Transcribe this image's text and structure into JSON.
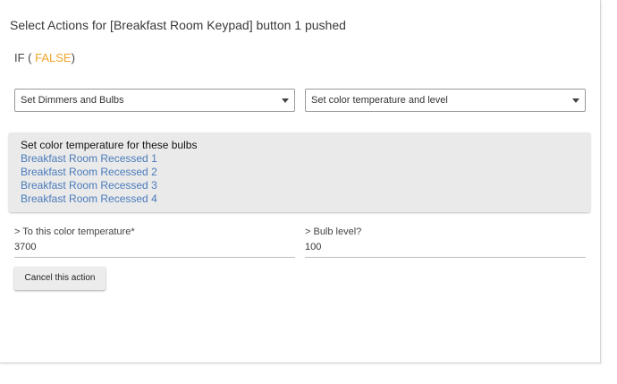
{
  "heading": "Select Actions for [Breakfast Room Keypad] button 1 pushed",
  "condition": {
    "prefix": "IF ( ",
    "value": "FALSE",
    "suffix": ")"
  },
  "colors": {
    "false_text": "#f0a52c",
    "link_text": "#4a7bbb"
  },
  "action_category_select": {
    "value": "Set Dimmers and Bulbs",
    "icon": "chevron-down-icon"
  },
  "action_type_select": {
    "value": "Set color temperature and level",
    "icon": "chevron-down-icon"
  },
  "bulbs_panel": {
    "title": "Set color temperature for these bulbs",
    "bulbs": [
      "Breakfast Room Recessed 1",
      "Breakfast Room Recessed 2",
      "Breakfast Room Recessed 3",
      "Breakfast Room Recessed 4"
    ]
  },
  "color_temperature_field": {
    "label": "> To this color temperature*",
    "value": "3700"
  },
  "bulb_level_field": {
    "label": "> Bulb level?",
    "value": "100"
  },
  "cancel_button": {
    "label": "Cancel this action"
  }
}
